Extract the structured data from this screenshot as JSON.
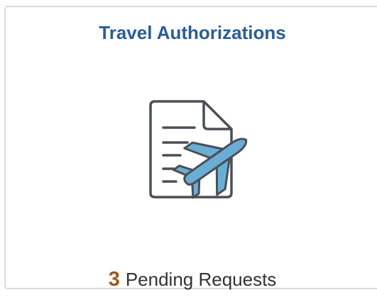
{
  "tile": {
    "title": "Travel Authorizations",
    "icon": "document-airplane-icon",
    "count": "3",
    "count_label": "Pending Requests"
  },
  "colors": {
    "title": "#2b5d96",
    "count": "#9c5a1b",
    "label": "#333333",
    "icon_stroke": "#4a4f55",
    "airplane": "#6aaed6"
  }
}
